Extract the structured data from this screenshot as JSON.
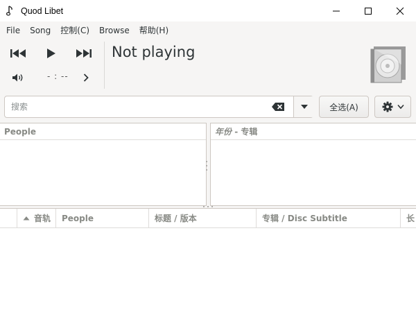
{
  "window": {
    "title": "Quod Libet"
  },
  "menu": [
    "File",
    "Song",
    "控制(C)",
    "Browse",
    "帮助(H)"
  ],
  "player": {
    "time": "- : --",
    "status": "Not playing"
  },
  "search": {
    "placeholder": "搜索",
    "select_all_label": "全选(A)"
  },
  "panes": {
    "left_header": "People",
    "right_header_italic": "年份",
    "right_header_rest": " - 专辑"
  },
  "columns": [
    "音轨",
    "People",
    "标题 / 版本",
    "专辑 / Disc Subtitle",
    "长"
  ]
}
